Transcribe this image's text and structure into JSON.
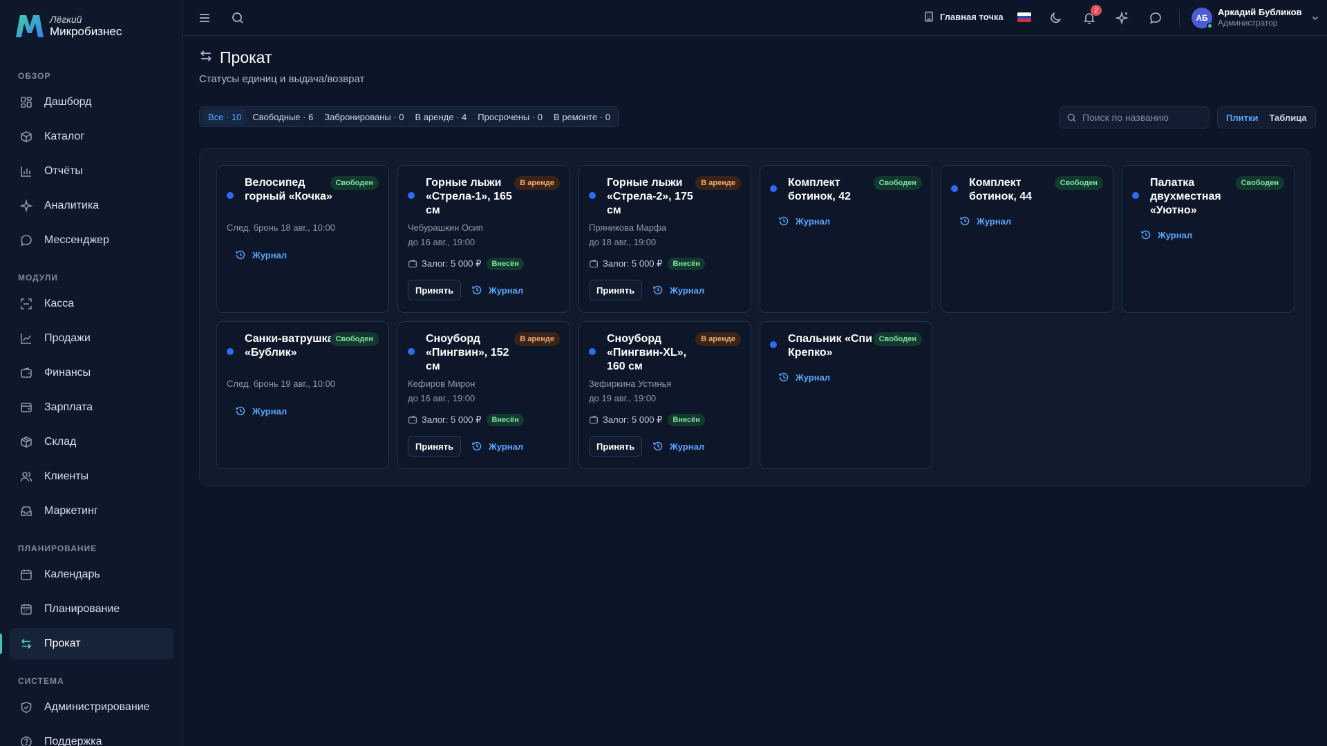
{
  "brand": {
    "light": "Лёгкий",
    "name": "Микробизнес"
  },
  "sidebar": {
    "sections": {
      "overview": "ОБЗОР",
      "modules": "МОДУЛИ",
      "planning": "ПЛАНИРОВАНИЕ",
      "system": "СИСТЕМА"
    },
    "items": {
      "dashboard": "Дашборд",
      "catalog": "Каталог",
      "reports": "Отчёты",
      "analytics": "Аналитика",
      "messenger": "Мессенджер",
      "cashier": "Касса",
      "sales": "Продажи",
      "finance": "Финансы",
      "salary": "Зарплата",
      "warehouse": "Склад",
      "clients": "Клиенты",
      "marketing": "Маркетинг",
      "calendar": "Календарь",
      "planning": "Планирование",
      "rental": "Прокат",
      "admin": "Администрирование",
      "support": "Поддержка"
    },
    "active": "rental"
  },
  "topbar": {
    "point": "Главная точка",
    "notifications_count": "2",
    "user_initials": "АБ",
    "user_name": "Аркадий Бубликов",
    "user_role": "Администратор"
  },
  "page": {
    "title": "Прокат",
    "subtitle": "Статусы единиц и выдача/возврат"
  },
  "filters": {
    "all": "Все · 10",
    "free": "Свободные · 6",
    "booked": "Забронированы · 0",
    "rented": "В аренде · 4",
    "overdue": "Просрочены · 0",
    "repair": "В ремонте · 0"
  },
  "search": {
    "placeholder": "Поиск по названию"
  },
  "view": {
    "tiles": "Плитки",
    "table": "Таблица"
  },
  "labels": {
    "journal": "Журнал",
    "accept": "Принять",
    "paid": "Внесён"
  },
  "cards": [
    {
      "name": "Велосипед горный «Кочка»",
      "status": "Свободен",
      "booking": "След. бронь 18 авг., 10:00"
    },
    {
      "name": "Горные лыжи «Стрела-1», 165 см",
      "status": "В аренде",
      "renter": "Чебурашкин Осип",
      "until": "до 16 авг., 19:00",
      "deposit": "Залог: 5 000 ₽"
    },
    {
      "name": "Горные лыжи «Стрела-2», 175 см",
      "status": "В аренде",
      "renter": "Пряникова Марфа",
      "until": "до 18 авг., 19:00",
      "deposit": "Залог: 5 000 ₽"
    },
    {
      "name": "Комплект ботинок, 42",
      "status": "Свободен"
    },
    {
      "name": "Комплект ботинок, 44",
      "status": "Свободен"
    },
    {
      "name": "Палатка двухместная «Уютно»",
      "status": "Свободен"
    },
    {
      "name": "Санки-ватрушка «Бублик»",
      "status": "Свободен",
      "booking": "След. бронь 19 авг., 10:00"
    },
    {
      "name": "Сноуборд «Пингвин», 152 см",
      "status": "В аренде",
      "renter": "Кефиров Мирон",
      "until": "до 16 авг., 19:00",
      "deposit": "Залог: 5 000 ₽"
    },
    {
      "name": "Сноуборд «Пингвин-XL», 160 см",
      "status": "В аренде",
      "renter": "Зефиркина Устинья",
      "until": "до 19 авг., 19:00",
      "deposit": "Залог: 5 000 ₽"
    },
    {
      "name": "Спальник «Спи Крепко»",
      "status": "Свободен"
    }
  ],
  "colors": {
    "accent": "#5aa6ff",
    "active_indicator": "#3ec6b7",
    "status_free": "#7ee0a7",
    "status_rent": "#f0a978",
    "item_dot": "#2b6ef2"
  }
}
